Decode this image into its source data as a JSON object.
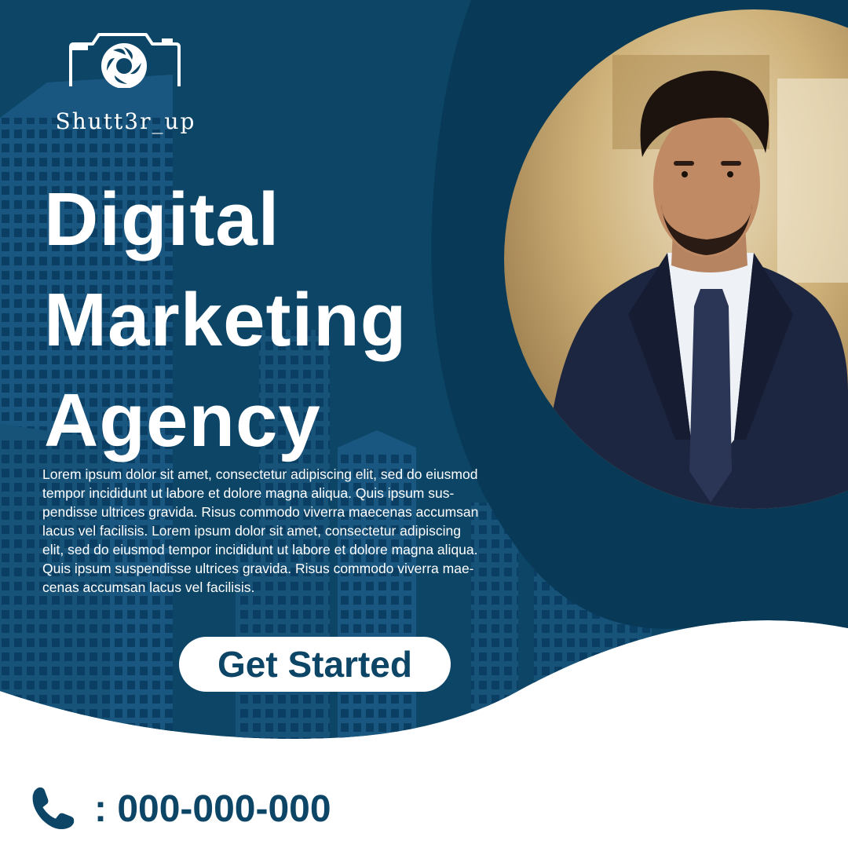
{
  "brand": {
    "name": "Shutt3r_up",
    "logo_icon": "camera-aperture-icon"
  },
  "headline": {
    "line1": "Digital",
    "line2": "Marketing",
    "line3": "Agency"
  },
  "body": {
    "text": "Lorem ipsum dolor sit amet, consectetur adipiscing elit, sed do eiusmod tempor incididunt ut labore et dolore magna aliqua. Quis ipsum sus-pendisse ultrices gravida. Risus commodo viverra maecenas accumsan lacus vel facilisis. Lorem ipsum dolor sit amet, consectetur adipiscing elit, sed do eiusmod tempor incididunt ut labore et dolore magna aliqua. Quis ipsum suspendisse ultrices gravida. Risus commodo viverra mae-cenas accumsan lacus vel facilisis."
  },
  "cta": {
    "label": "Get Started"
  },
  "contact": {
    "icon": "phone-icon",
    "number": ": 000-000-000"
  },
  "colors": {
    "primary_navy": "#0c4566",
    "dark_band": "#083a58",
    "white": "#ffffff"
  }
}
